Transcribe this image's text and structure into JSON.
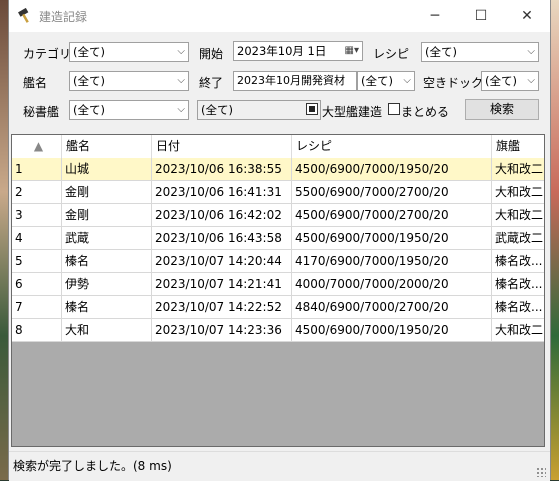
{
  "window": {
    "title": "建造記録",
    "minimize": "─",
    "maximize": "☐",
    "close": "✕"
  },
  "filters": {
    "category_label": "カテゴリ",
    "category_value": "(全て)",
    "start_label": "開始",
    "start_value": "2023年10月  1日",
    "recipe_label": "レシピ",
    "recipe_value": "(全て)",
    "ship_label": "艦名",
    "ship_value": "(全て)",
    "end_label": "終了",
    "end_value": "2023年10月開発資材",
    "devmat_value": "(全て)",
    "dock_label": "空きドック",
    "dock_value": "(全て)",
    "secretary_label": "秘書艦",
    "secretary_value": "(全て)",
    "secretary2_value": "(全て)",
    "large_build_label": "大型艦建造",
    "merge_label": "まとめる",
    "search_button": "検索"
  },
  "table": {
    "sort_indicator": "▲",
    "columns": [
      "艦名",
      "日付",
      "レシピ",
      "旗艦"
    ],
    "rows": [
      {
        "no": "1",
        "ship": "山城",
        "date": "2023/10/06 16:38:55",
        "recipe": "4500/6900/7000/1950/20",
        "flag": "大和改二"
      },
      {
        "no": "2",
        "ship": "金剛",
        "date": "2023/10/06 16:41:31",
        "recipe": "5500/6900/7000/2700/20",
        "flag": "大和改二"
      },
      {
        "no": "3",
        "ship": "金剛",
        "date": "2023/10/06 16:42:02",
        "recipe": "4500/6900/7000/2700/20",
        "flag": "大和改二"
      },
      {
        "no": "4",
        "ship": "武蔵",
        "date": "2023/10/06 16:43:58",
        "recipe": "4500/6900/7000/1950/20",
        "flag": "武蔵改二"
      },
      {
        "no": "5",
        "ship": "榛名",
        "date": "2023/10/07 14:20:44",
        "recipe": "4170/6900/7000/1950/20",
        "flag": "榛名改..."
      },
      {
        "no": "6",
        "ship": "伊勢",
        "date": "2023/10/07 14:21:41",
        "recipe": "4000/7000/7000/2000/20",
        "flag": "榛名改..."
      },
      {
        "no": "7",
        "ship": "榛名",
        "date": "2023/10/07 14:22:52",
        "recipe": "4840/6900/7000/2700/20",
        "flag": "榛名改..."
      },
      {
        "no": "8",
        "ship": "大和",
        "date": "2023/10/07 14:23:36",
        "recipe": "4500/6900/7000/1950/20",
        "flag": "大和改二"
      }
    ]
  },
  "status": {
    "text": "検索が完了しました。(8 ms)"
  }
}
